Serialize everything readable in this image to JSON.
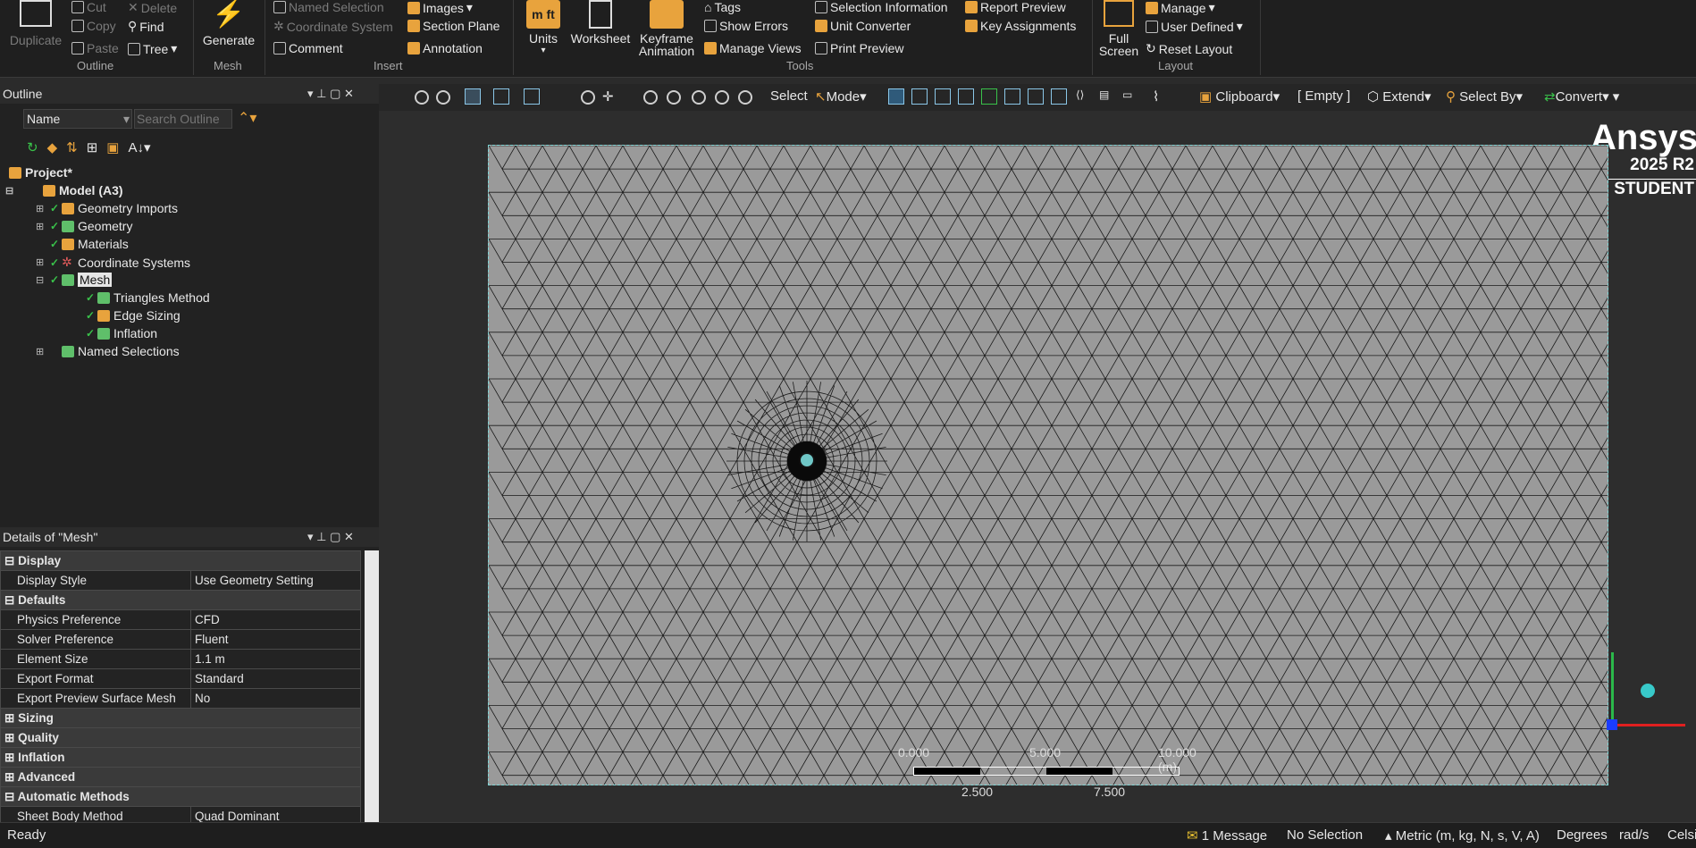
{
  "ribbon": {
    "clipboard": {
      "duplicate": "Duplicate",
      "cut": "Cut",
      "copy": "Copy",
      "paste": "Paste",
      "delete": "Delete",
      "find": "Find",
      "tree": "Tree",
      "group": "Outline"
    },
    "mesh": {
      "generate": "Generate",
      "group": "Mesh"
    },
    "insert": {
      "named_selection": "Named Selection",
      "coordinate_system": "Coordinate System",
      "comment": "Comment",
      "images": "Images",
      "section_plane": "Section Plane",
      "annotation": "Annotation",
      "group": "Insert"
    },
    "tools": {
      "units": "Units",
      "worksheet": "Worksheet",
      "keyframe": "Keyframe",
      "animation": "Animation",
      "tags": "Tags",
      "show_errors": "Show Errors",
      "manage_views": "Manage Views",
      "selection_information": "Selection Information",
      "unit_converter": "Unit Converter",
      "print_preview": "Print Preview",
      "report_preview": "Report Preview",
      "key_assignments": "Key Assignments",
      "group": "Tools"
    },
    "layout": {
      "full": "Full",
      "screen": "Screen",
      "manage": "Manage",
      "user_defined": "User Defined",
      "reset_layout": "Reset Layout",
      "group": "Layout"
    }
  },
  "outline": {
    "title": "Outline",
    "name_select": "Name",
    "search_placeholder": "Search Outline",
    "tree": [
      {
        "label": "Project*"
      },
      {
        "label": "Model (A3)"
      },
      {
        "label": "Geometry Imports"
      },
      {
        "label": "Geometry"
      },
      {
        "label": "Materials"
      },
      {
        "label": "Coordinate Systems"
      },
      {
        "label": "Mesh"
      },
      {
        "label": "Triangles Method"
      },
      {
        "label": "Edge Sizing"
      },
      {
        "label": "Inflation"
      },
      {
        "label": "Named Selections"
      }
    ]
  },
  "details": {
    "title": "Details of \"Mesh\"",
    "rows": [
      {
        "type": "cat",
        "label": "Display"
      },
      {
        "type": "row",
        "key": "Display Style",
        "value": "Use Geometry Setting"
      },
      {
        "type": "cat",
        "label": "Defaults"
      },
      {
        "type": "row",
        "key": "Physics Preference",
        "value": "CFD"
      },
      {
        "type": "row",
        "key": "Solver Preference",
        "value": "Fluent"
      },
      {
        "type": "row",
        "key": "Element Size",
        "value": "1.1 m"
      },
      {
        "type": "row",
        "key": "Export Format",
        "value": "Standard"
      },
      {
        "type": "row",
        "key": "Export Preview Surface Mesh",
        "value": "No"
      },
      {
        "type": "cat",
        "label": "Sizing"
      },
      {
        "type": "cat",
        "label": "Quality"
      },
      {
        "type": "cat",
        "label": "Inflation"
      },
      {
        "type": "cat",
        "label": "Advanced"
      },
      {
        "type": "cat",
        "label": "Automatic Methods"
      },
      {
        "type": "row",
        "key": "Sheet Body Method",
        "value": "Quad Dominant"
      }
    ]
  },
  "viewtoolbar": {
    "select": "Select",
    "mode": "Mode",
    "clipboard": "Clipboard",
    "empty": "[ Empty ]",
    "extend": "Extend",
    "select_by": "Select By",
    "convert": "Convert"
  },
  "viewport": {
    "brand": "Ansys",
    "version": "2025 R2",
    "edition": "STUDENT",
    "scale": {
      "l0": "0.000",
      "l1": "5.000",
      "l2": "10.000 (m)",
      "l3": "2.500",
      "l4": "7.500"
    }
  },
  "status": {
    "ready": "Ready",
    "messages": "1 Message",
    "selection": "No Selection",
    "units": "Metric (m, kg, N, s, V, A)",
    "angle": "Degrees",
    "rate": "rad/s",
    "temp": "Celsius"
  },
  "colors": {
    "accent": "#e8a33d",
    "check": "#39c24a",
    "mesh_bg": "#9a9a9a"
  }
}
